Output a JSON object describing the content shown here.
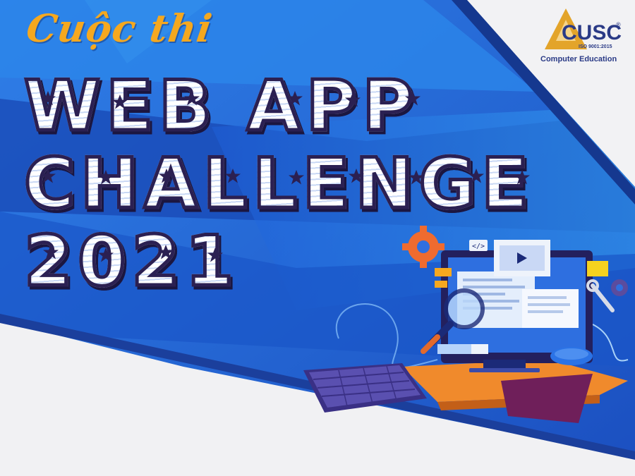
{
  "poster": {
    "script_title": "Cuộc thi",
    "title_line_1": "WEB APP",
    "title_line_2": "CHALLENGE",
    "title_line_3": "2021"
  },
  "logo": {
    "name": "CUSC",
    "registered": "®",
    "iso": "ISO 9001:2015",
    "tagline": "Computer Education"
  },
  "illustration": {
    "code_tag": "</>"
  },
  "colors": {
    "background_blue": "#1a5fd0",
    "dark_blue": "#1546a8",
    "light_blue": "#2f8ff0",
    "script_orange": "#f5a81f",
    "title_outline": "#2b2052",
    "logo_navy": "#2a3a86",
    "logo_gold": "#e3a42a"
  },
  "icons": [
    "gear-icon",
    "magnifier-icon",
    "wrench-icon",
    "play-icon",
    "star-icon"
  ]
}
